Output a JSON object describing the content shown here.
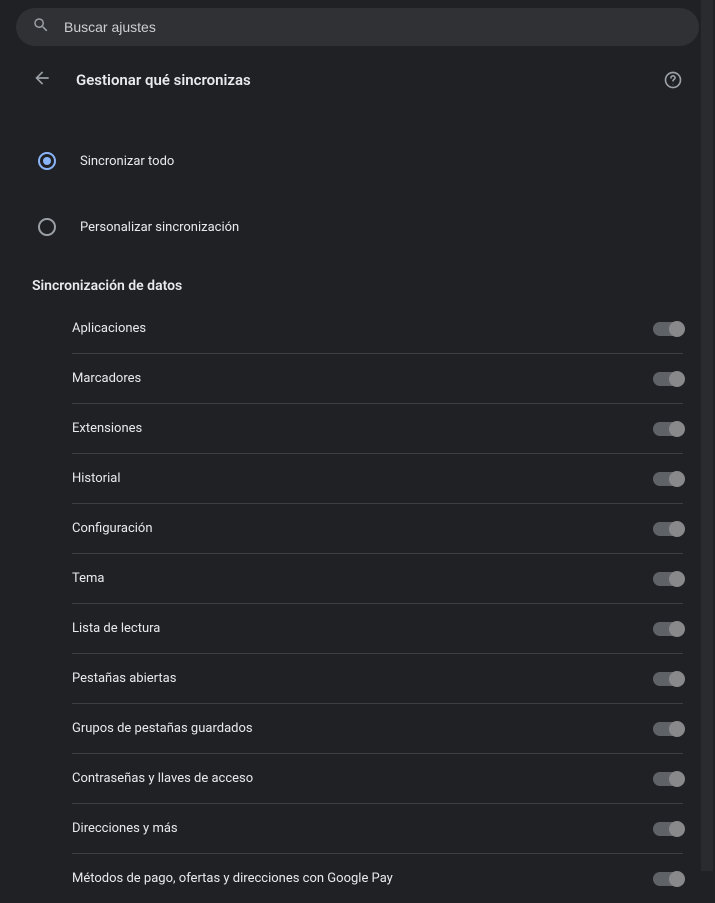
{
  "search": {
    "placeholder": "Buscar ajustes"
  },
  "header": {
    "title": "Gestionar qué sincronizas"
  },
  "radios": {
    "sync_all": {
      "label": "Sincronizar todo",
      "selected": true
    },
    "customize": {
      "label": "Personalizar sincronización",
      "selected": false
    }
  },
  "section_heading": "Sincronización de datos",
  "toggles": [
    {
      "label": "Aplicaciones"
    },
    {
      "label": "Marcadores"
    },
    {
      "label": "Extensiones"
    },
    {
      "label": "Historial"
    },
    {
      "label": "Configuración"
    },
    {
      "label": "Tema"
    },
    {
      "label": "Lista de lectura"
    },
    {
      "label": "Pestañas abiertas"
    },
    {
      "label": "Grupos de pestañas guardados"
    },
    {
      "label": "Contraseñas y llaves de acceso"
    },
    {
      "label": "Direcciones y más"
    },
    {
      "label": "Métodos de pago, ofertas y direcciones con Google Pay"
    }
  ]
}
